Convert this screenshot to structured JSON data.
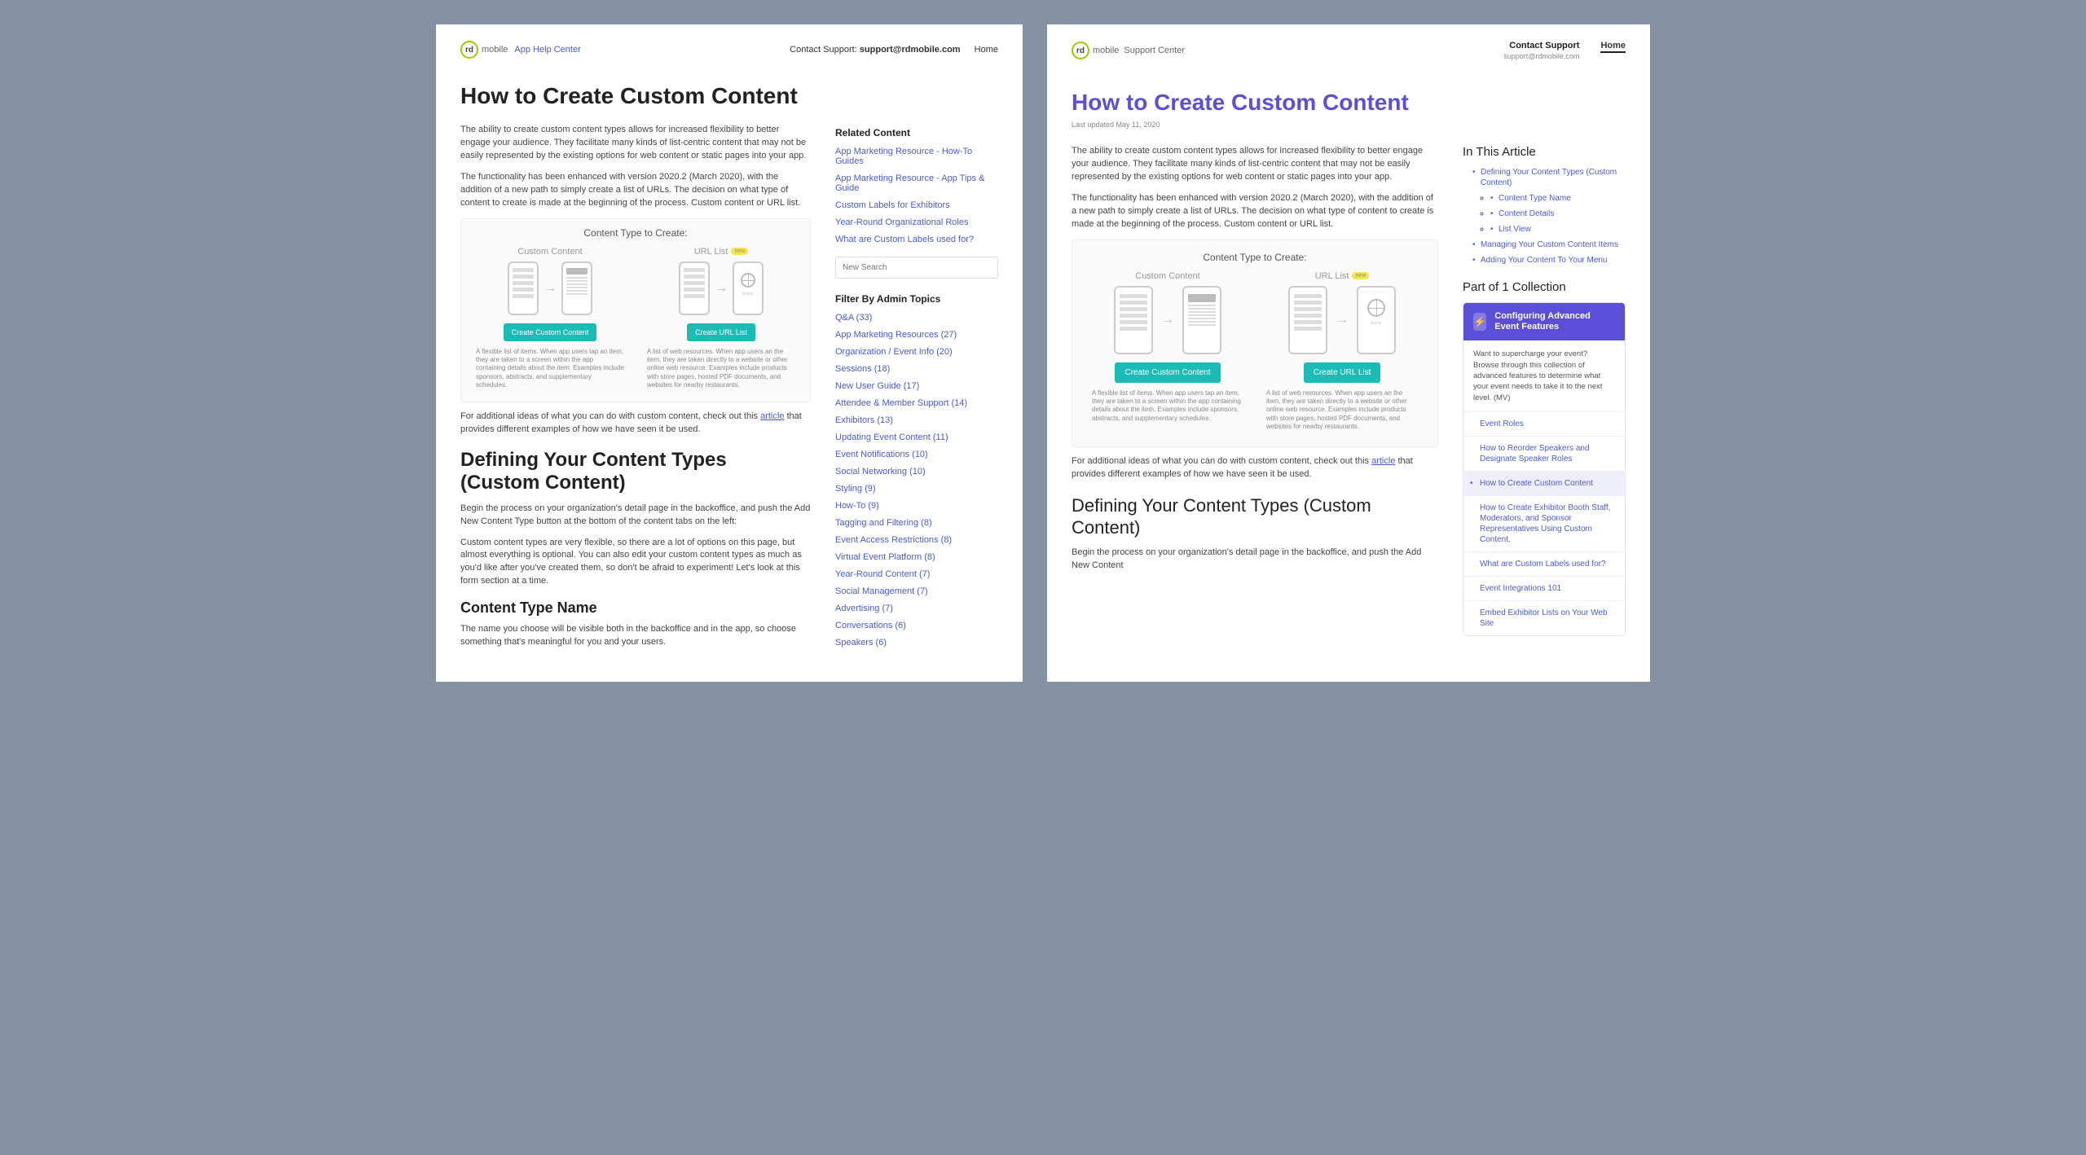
{
  "left": {
    "logo_text": "rd",
    "logo_mobile": "mobile",
    "logo_app": "App Help Center",
    "contact_label": "Contact Support:",
    "contact_email": "support@rdmobile.com",
    "home": "Home",
    "title": "How to Create Custom Content",
    "p1": "The ability to create custom content types allows for increased flexibility to better engage your audience. They facilitate many kinds of list-centric content that may not be easily represented by the existing options for web content or static pages into your app.",
    "p2": " The functionality has been enhanced with version 2020.2 (March 2020), with the addition of a new path to simply create a list of URLs. The decision on what type of content to create is made at the beginning of the process. Custom content or URL list.",
    "diagram": {
      "title": "Content Type to Create:",
      "custom_label": "Custom Content",
      "url_label": "URL List",
      "new_badge": "new",
      "custom_cta": "Create Custom Content",
      "url_cta": "Create URL List",
      "custom_caption": "A flexible list of items. When app users tap an item, they are taken to a screen within the app containing details about the item. Examples include sponsors, abstracts, and supplementary schedules.",
      "url_caption": "A list of web resources. When app users an the item, they are taken directly to a website or other online web resource. Examples include products with store pages, hosted PDF documents, and websites for nearby restaurants."
    },
    "p3a": "For additional ideas of what you can do with custom content, check out this ",
    "p3_link": "article",
    "p3b": " that provides different examples of how we have seen it be used.",
    "h2": "Defining Your Content Types (Custom Content)",
    "p4": "Begin the process on your organization's detail page in the backoffice, and push the Add New Content Type button at the bottom of the content tabs on the left:",
    "p5": "Custom content types are very flexible, so there are a lot of options on this page, but almost everything is optional. You can also edit your custom content types as much as you'd like after you've created them, so don't be afraid to experiment! Let's look at this form section at a time.",
    "h3": "Content Type Name",
    "p6": "The name you choose will be visible both in the backoffice and in the app, so choose something that's meaningful for you and your users.",
    "side": {
      "related_head": "Related Content",
      "related": [
        "App Marketing Resource - How-To Guides",
        "App Marketing Resource - App Tips & Guide",
        "Custom Labels for Exhibitors",
        "Year-Round Organizational Roles",
        "What are Custom Labels used for?"
      ],
      "search_placeholder": "New Search",
      "filter_head": "Filter By Admin Topics",
      "topics": [
        "Q&A (33)",
        "App Marketing Resources (27)",
        "Organization / Event Info (20)",
        "Sessions (18)",
        "New User Guide (17)",
        "Attendee & Member Support (14)",
        "Exhibitors (13)",
        "Updating Event Content (11)",
        "Event Notifications (10)",
        "Social Networking (10)",
        "Styling (9)",
        "How-To (9)",
        "Tagging and Filtering (8)",
        "Event Access Restrictions (8)",
        "Virtual Event Platform (8)",
        "Year-Round Content (7)",
        "Social Management (7)",
        "Advertising (7)",
        "Conversations (6)",
        "Speakers (6)"
      ]
    }
  },
  "right": {
    "logo_text": "rd",
    "logo_mobile": "mobile",
    "logo_app": "Support Center",
    "contact_label": "Contact Support",
    "contact_email": "support@rdmobile.com",
    "home": "Home",
    "title": "How to Create Custom Content",
    "updated": "Last updated May 11, 2020",
    "p1": "The ability to create custom content types allows for increased flexibility to better engage your audience. They facilitate many kinds of list-centric content that may not be easily represented by the existing options for web content or static pages into your app.",
    "p2": "The functionality has been enhanced with version 2020.2 (March 2020), with the addition of a new path to simply create a list of URLs. The decision on what type of content to create is made at the beginning of the process. Custom content or URL list.",
    "diagram": {
      "title": "Content Type to Create:",
      "custom_label": "Custom Content",
      "url_label": "URL List",
      "new_badge": "new",
      "custom_cta": "Create Custom Content",
      "url_cta": "Create URL List",
      "custom_caption": "A flexible list of items. When app users tap an item, they are taken to a screen within the app containing details about the item. Examples include sponsors, abstracts, and supplementary schedules.",
      "url_caption": "A list of web resources. When app users an the item, they are taken directly to a website or other online web resource. Examples include products with store pages, hosted PDF documents, and websites for nearby restaurants."
    },
    "p3a": "For additional ideas of what you can do with custom content, check out this ",
    "p3_link": "article",
    "p3b": " that provides different examples of how we have seen it be used.",
    "h2": "Defining Your Content Types (Custom Content)",
    "p4": "Begin the process on your organization's detail page in the backoffice, and push the Add New Content",
    "side": {
      "toc_head": "In This Article",
      "toc": {
        "i1": "Defining Your Content Types (Custom Content)",
        "i1a": "Content Type Name",
        "i1b": "Content Details",
        "i1c": "List View",
        "i2": "Managing Your Custom Content Items",
        "i3": "Adding Your Content To Your Menu"
      },
      "part_head": "Part of 1 Collection",
      "coll_title": "Configuring Advanced Event Features",
      "coll_body": "Want to supercharge your event? Browse through this collection of advanced features to determine what your event needs to take it to the next level. (MV)",
      "coll_items": [
        "Event Roles",
        "How to Reorder Speakers and Designate Speaker Roles",
        "How to Create Custom Content",
        "How to Create Exhibitor Booth Staff, Moderators, and Sponsor Representatives Using Custom Content.",
        "What are Custom Labels used for?",
        "Event Integrations 101",
        "Embed Exhibitor Lists on Your Web Site"
      ],
      "coll_active_index": 2
    }
  }
}
